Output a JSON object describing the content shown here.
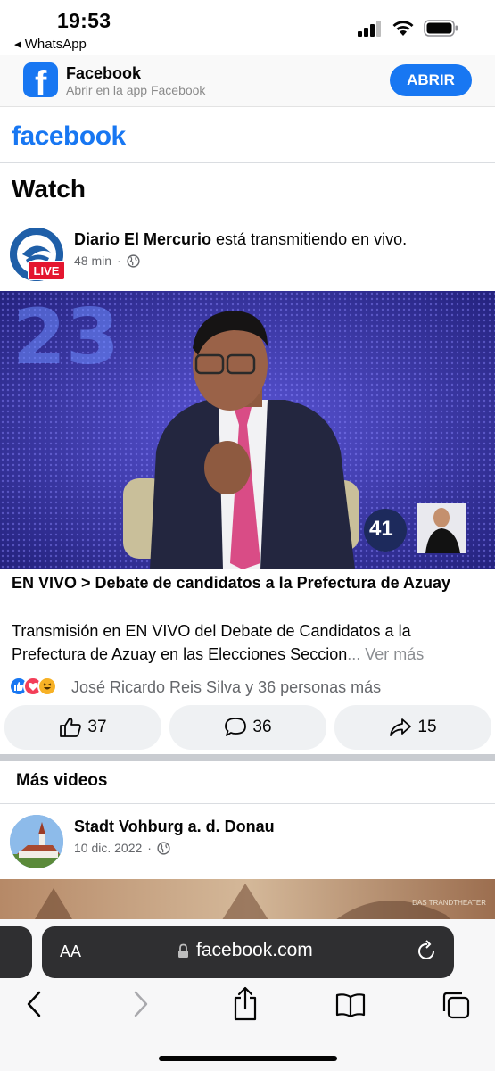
{
  "status_bar": {
    "time": "19:53",
    "back_app": "◂ WhatsApp"
  },
  "app_banner": {
    "title": "Facebook",
    "subtitle": "Abrir en la app Facebook",
    "open_label": "ABRIR"
  },
  "header": {
    "logo": "facebook"
  },
  "page": {
    "title": "Watch"
  },
  "post": {
    "author": "Diario El Mercurio",
    "author_suffix": " está transmitiendo en vivo.",
    "live_badge": "LIVE",
    "time": "48 min",
    "separator": "·",
    "video_channel_number": "41",
    "video_overlay_number": "23",
    "title": "EN VIVO > Debate de candidatos a la Prefectura de Azuay",
    "description": "Transmisión en EN VIVO del Debate de Candidatos a la Prefectura de Azuay en las Elecciones Seccion",
    "see_more": "... Ver más",
    "reactions_text": "José Ricardo Reis Silva y 36 personas más",
    "like_count": "37",
    "comment_count": "36",
    "share_count": "15"
  },
  "more_videos": {
    "heading": "Más videos",
    "author": "Stadt Vohburg a. d. Donau",
    "date": "10 dic. 2022",
    "separator": "·",
    "video_watermark": "DAS TRANDTHEATER"
  },
  "safari": {
    "text_size_label": "AA",
    "url": "facebook.com"
  },
  "colors": {
    "brand_blue": "#1877f2",
    "live_red": "#e4162f",
    "secondary_text": "#65676b"
  }
}
